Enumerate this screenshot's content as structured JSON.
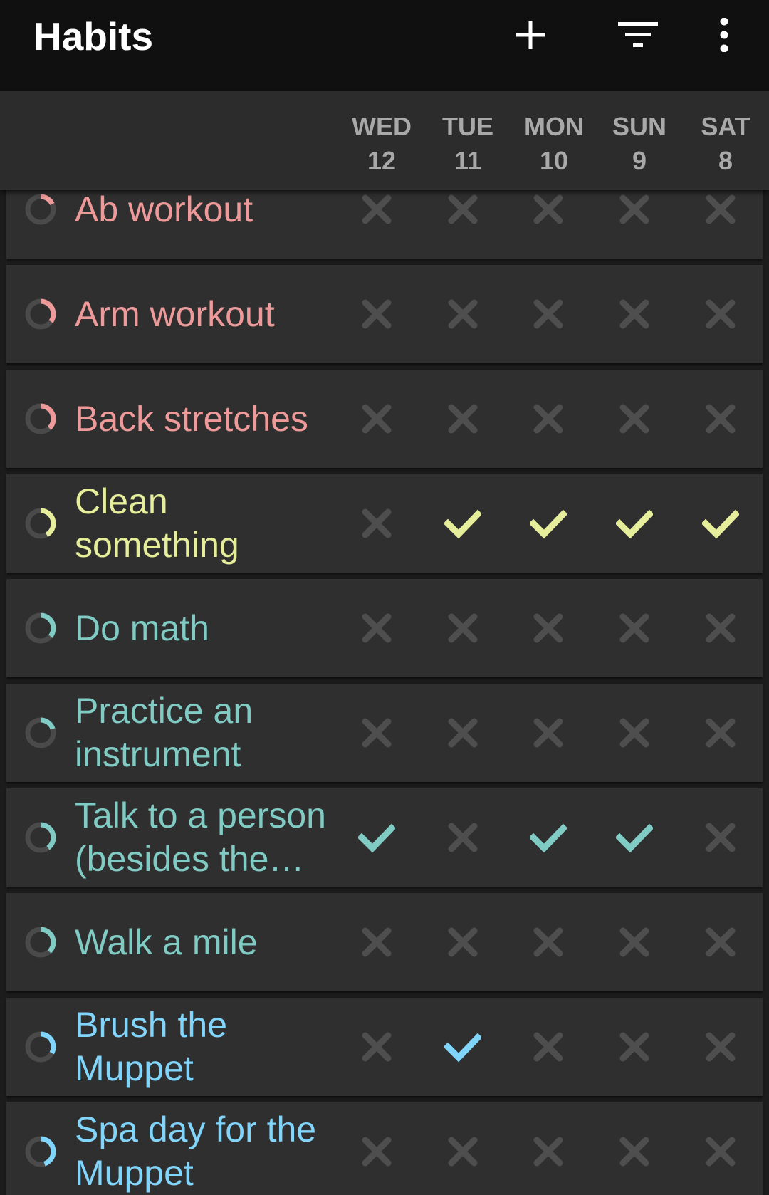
{
  "toolbar": {
    "title": "Habits",
    "icons": [
      "add-icon",
      "filter-icon",
      "more-vert-icon"
    ]
  },
  "days": [
    {
      "weekday": "WED",
      "day": "12"
    },
    {
      "weekday": "TUE",
      "day": "11"
    },
    {
      "weekday": "MON",
      "day": "10"
    },
    {
      "weekday": "SUN",
      "day": "9"
    },
    {
      "weekday": "SAT",
      "day": "8"
    }
  ],
  "colors": {
    "unchecked": "#4e4e4e",
    "ring_track": "#4a4a4a"
  },
  "habits": [
    {
      "name": "Ab workout",
      "color": "#ef9a9a",
      "score": 0.18,
      "checks": [
        false,
        false,
        false,
        false,
        false
      ]
    },
    {
      "name": "Arm workout",
      "color": "#ef9a9a",
      "score": 0.35,
      "checks": [
        false,
        false,
        false,
        false,
        false
      ]
    },
    {
      "name": "Back stretches",
      "color": "#ef9a9a",
      "score": 0.38,
      "checks": [
        false,
        false,
        false,
        false,
        false
      ]
    },
    {
      "name": "Clean something",
      "color": "#e6ee9c",
      "score": 0.42,
      "checks": [
        false,
        true,
        true,
        true,
        true
      ]
    },
    {
      "name": "Do math",
      "color": "#80cbc4",
      "score": 0.36,
      "checks": [
        false,
        false,
        false,
        false,
        false
      ]
    },
    {
      "name": "Practice an instrument",
      "color": "#80cbc4",
      "score": 0.2,
      "checks": [
        false,
        false,
        false,
        false,
        false
      ]
    },
    {
      "name": "Talk to a person (besides the Muppet)",
      "color": "#80cbc4",
      "score": 0.4,
      "checks": [
        true,
        false,
        true,
        true,
        false
      ]
    },
    {
      "name": "Walk a mile",
      "color": "#80cbc4",
      "score": 0.38,
      "checks": [
        false,
        false,
        false,
        false,
        false
      ]
    },
    {
      "name": "Brush the Muppet",
      "color": "#81d4fa",
      "score": 0.33,
      "checks": [
        false,
        true,
        false,
        false,
        false
      ]
    },
    {
      "name": "Spa day for the Muppet",
      "color": "#81d4fa",
      "score": 0.45,
      "checks": [
        false,
        false,
        false,
        false,
        false
      ]
    }
  ]
}
